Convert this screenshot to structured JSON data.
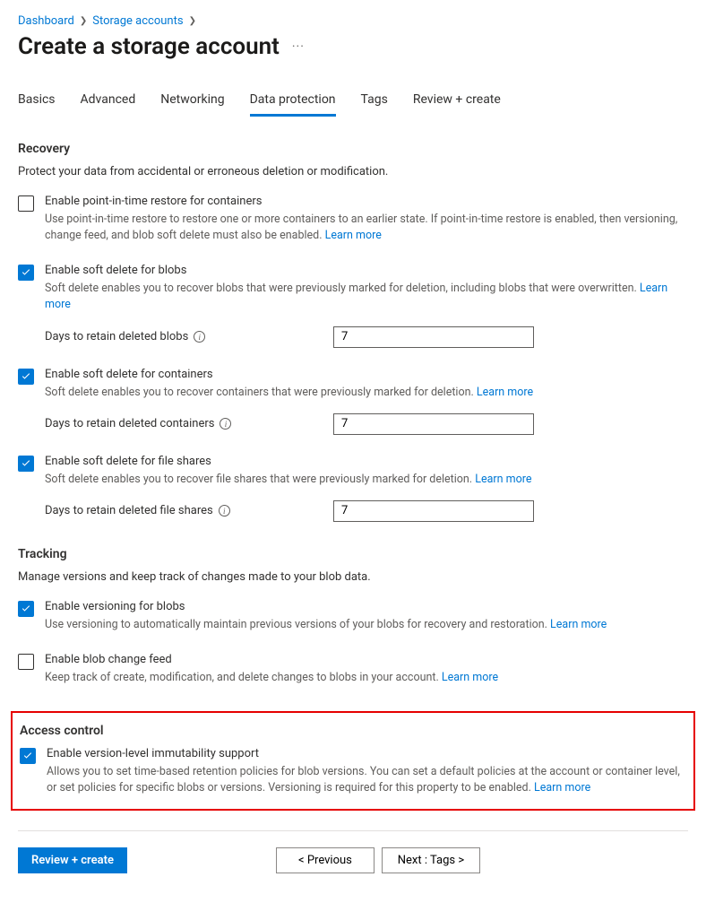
{
  "breadcrumb": {
    "dashboard": "Dashboard",
    "storage_accounts": "Storage accounts"
  },
  "page_title": "Create a storage account",
  "tabs": {
    "basics": "Basics",
    "advanced": "Advanced",
    "networking": "Networking",
    "data_protection": "Data protection",
    "tags": "Tags",
    "review_create": "Review + create"
  },
  "recovery": {
    "title": "Recovery",
    "desc": "Protect your data from accidental or erroneous deletion or modification.",
    "pitr": {
      "label": "Enable point-in-time restore for containers",
      "desc": "Use point-in-time restore to restore one or more containers to an earlier state. If point-in-time restore is enabled, then versioning, change feed, and blob soft delete must also be enabled.",
      "learn_more": "Learn more"
    },
    "soft_delete_blobs": {
      "label": "Enable soft delete for blobs",
      "desc": "Soft delete enables you to recover blobs that were previously marked for deletion, including blobs that were overwritten.",
      "learn_more": "Learn more",
      "field_label": "Days to retain deleted blobs",
      "value": "7"
    },
    "soft_delete_containers": {
      "label": "Enable soft delete for containers",
      "desc": "Soft delete enables you to recover containers that were previously marked for deletion.",
      "learn_more": "Learn more",
      "field_label": "Days to retain deleted containers",
      "value": "7"
    },
    "soft_delete_fileshares": {
      "label": "Enable soft delete for file shares",
      "desc": "Soft delete enables you to recover file shares that were previously marked for deletion.",
      "learn_more": "Learn more",
      "field_label": "Days to retain deleted file shares",
      "value": "7"
    }
  },
  "tracking": {
    "title": "Tracking",
    "desc": "Manage versions and keep track of changes made to your blob data.",
    "versioning": {
      "label": "Enable versioning for blobs",
      "desc": "Use versioning to automatically maintain previous versions of your blobs for recovery and restoration.",
      "learn_more": "Learn more"
    },
    "change_feed": {
      "label": "Enable blob change feed",
      "desc": "Keep track of create, modification, and delete changes to blobs in your account.",
      "learn_more": "Learn more"
    }
  },
  "access_control": {
    "title": "Access control",
    "immutability": {
      "label": "Enable version-level immutability support",
      "desc": "Allows you to set time-based retention policies for blob versions. You can set a default policies at the account or container level, or set policies for specific blobs or versions. Versioning is required for this property to be enabled.",
      "learn_more": "Learn more"
    }
  },
  "footer": {
    "review_create": "Review + create",
    "previous": "<  Previous",
    "next": "Next : Tags  >"
  }
}
